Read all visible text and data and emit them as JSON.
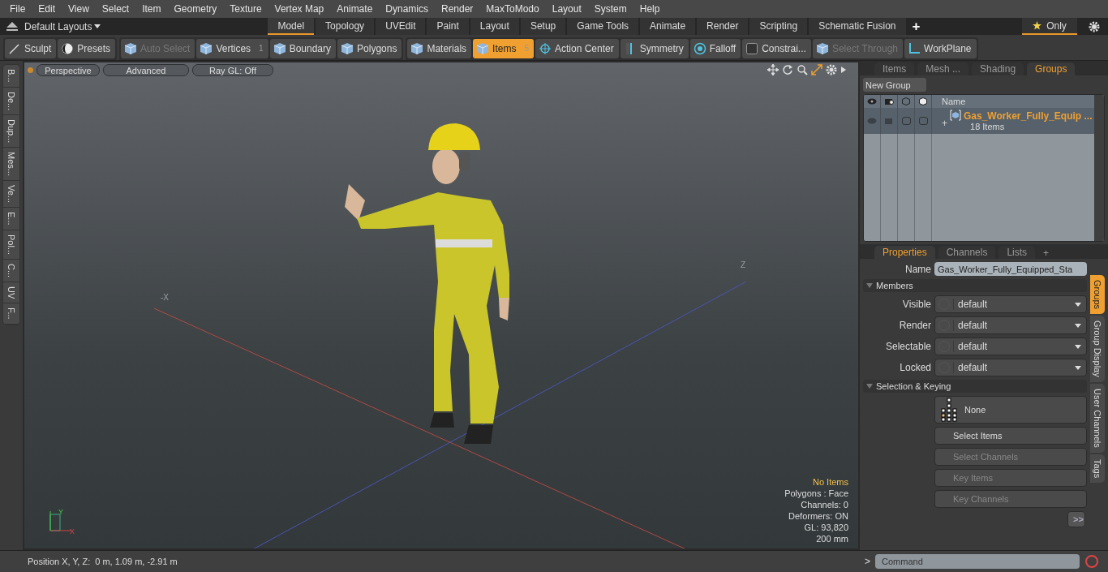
{
  "menu": [
    "File",
    "Edit",
    "View",
    "Select",
    "Item",
    "Geometry",
    "Texture",
    "Vertex Map",
    "Animate",
    "Dynamics",
    "Render",
    "MaxToModo",
    "Layout",
    "System",
    "Help"
  ],
  "layout_bar": {
    "preset": "Default Layouts",
    "tabs": [
      {
        "label": "Model",
        "selected": true
      },
      {
        "label": "Topology",
        "selected": false
      },
      {
        "label": "UVEdit",
        "selected": false
      },
      {
        "label": "Paint",
        "selected": false
      },
      {
        "label": "Layout",
        "selected": false
      },
      {
        "label": "Setup",
        "selected": false
      },
      {
        "label": "Game Tools",
        "selected": false
      },
      {
        "label": "Animate",
        "selected": false
      },
      {
        "label": "Render",
        "selected": false
      },
      {
        "label": "Scripting",
        "selected": false
      },
      {
        "label": "Schematic Fusion",
        "selected": false
      }
    ],
    "add": "+",
    "only": "Only"
  },
  "toolbar": [
    {
      "items": [
        {
          "label": "Sculpt",
          "kind": "brush",
          "selected": false,
          "disabled": false
        },
        {
          "label": "Presets",
          "kind": "sphere",
          "selected": false,
          "disabled": false
        }
      ]
    },
    {
      "items": [
        {
          "label": "Auto Select",
          "kind": "cube",
          "selected": false,
          "disabled": true
        },
        {
          "label": "Vertices",
          "kind": "cube",
          "count": "1",
          "selected": false,
          "disabled": false
        },
        {
          "label": "Boundary",
          "kind": "cube",
          "selected": false,
          "disabled": false
        },
        {
          "label": "Polygons",
          "kind": "cube",
          "selected": false,
          "disabled": false
        }
      ]
    },
    {
      "items": [
        {
          "label": "Materials",
          "kind": "cube",
          "selected": false,
          "disabled": false
        },
        {
          "label": "Items",
          "kind": "cube",
          "count": "5",
          "selected": true,
          "disabled": false
        },
        {
          "label": "Action Center",
          "kind": "crosshair",
          "selected": false,
          "disabled": false
        },
        {
          "label": "Symmetry",
          "kind": "bar",
          "selected": false,
          "disabled": false
        },
        {
          "label": "Falloff",
          "kind": "target",
          "selected": false,
          "disabled": false
        },
        {
          "label": "Constrai...",
          "kind": "square",
          "selected": false,
          "disabled": false
        },
        {
          "label": "Select Through",
          "kind": "cube",
          "selected": false,
          "disabled": true
        },
        {
          "label": "WorkPlane",
          "kind": "plane",
          "selected": false,
          "disabled": false
        }
      ]
    }
  ],
  "left_tabs": [
    "B...",
    "De...",
    "Dup...",
    "Mes...",
    "Ve...",
    "E...",
    "Pol...",
    "C...",
    "UV",
    "F..."
  ],
  "viewport": {
    "buttons": [
      "Perspective",
      "Advanced",
      "Ray GL: Off"
    ],
    "axis_labels": [
      "-X",
      "Z"
    ],
    "gizmo_labels": [
      "Y",
      "X"
    ],
    "info": [
      {
        "text": "No Items",
        "highlight": true
      },
      {
        "text": "Polygons : Face",
        "highlight": false
      },
      {
        "text": "Channels: 0",
        "highlight": false
      },
      {
        "text": "Deformers: ON",
        "highlight": false
      },
      {
        "text": "GL: 93,820",
        "highlight": false
      },
      {
        "text": "200 mm",
        "highlight": false
      }
    ]
  },
  "groups_panel": {
    "tabs": [
      {
        "label": "Items",
        "selected": false
      },
      {
        "label": "Mesh ...",
        "selected": false
      },
      {
        "label": "Shading",
        "selected": false
      },
      {
        "label": "Groups",
        "selected": true
      }
    ],
    "new_group": "New Group",
    "name_column": "Name",
    "rows": [
      {
        "name": "Gas_Worker_Fully_Equip ...",
        "count": "18 Items",
        "expand": "+",
        "selectable": false,
        "locked": false
      }
    ]
  },
  "properties": {
    "tabs": [
      {
        "label": "Properties",
        "selected": true
      },
      {
        "label": "Channels",
        "selected": false
      },
      {
        "label": "Lists",
        "selected": false
      }
    ],
    "add": "+",
    "name_label": "Name",
    "name_value": "Gas_Worker_Fully_Equipped_Sta",
    "members_title": "Members",
    "members": [
      {
        "label": "Visible",
        "value": "default"
      },
      {
        "label": "Render",
        "value": "default"
      },
      {
        "label": "Selectable",
        "value": "default"
      },
      {
        "label": "Locked",
        "value": "default"
      }
    ],
    "keying_title": "Selection & Keying",
    "none_button": "None",
    "buttons": [
      {
        "label": "Select Items",
        "disabled": false
      },
      {
        "label": "Select Channels",
        "disabled": true
      },
      {
        "label": "Key Items",
        "disabled": true
      },
      {
        "label": "Key Channels",
        "disabled": true
      }
    ],
    "more": ">>",
    "side_tabs": [
      {
        "label": "Groups",
        "selected": true
      },
      {
        "label": "Group Display",
        "selected": false
      },
      {
        "label": "User Channels",
        "selected": false
      },
      {
        "label": "Tags",
        "selected": false
      }
    ]
  },
  "status_bar": {
    "label": "Position X, Y, Z:",
    "value": "0 m, 1.09 m, -2.91 m",
    "prompt": ">",
    "command_placeholder": "Command"
  }
}
